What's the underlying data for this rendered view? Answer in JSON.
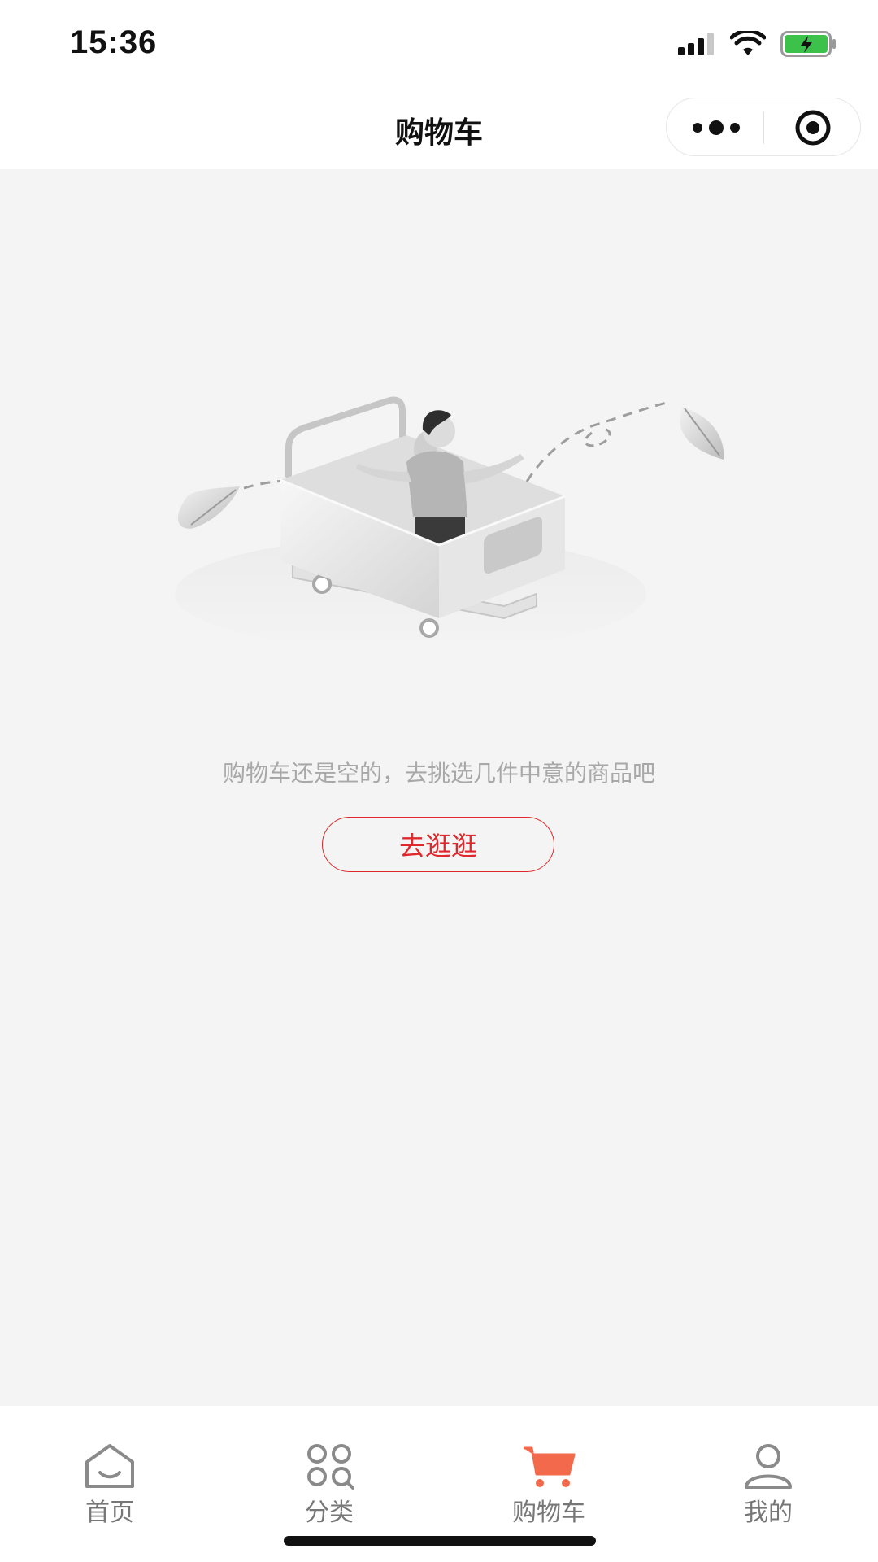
{
  "status_bar": {
    "time": "15:36",
    "signal_icon": "cellular-signal-icon",
    "wifi_icon": "wifi-icon",
    "battery_icon": "battery-charging-icon"
  },
  "nav": {
    "title": "购物车",
    "more_icon": "more-dots-icon",
    "close_icon": "target-circle-icon"
  },
  "empty_state": {
    "illustration": "empty-cart-illustration",
    "message": "购物车还是空的，去挑选几件中意的商品吧",
    "button_label": "去逛逛"
  },
  "tabs": [
    {
      "label": "首页",
      "icon": "home-icon"
    },
    {
      "label": "分类",
      "icon": "category-icon"
    },
    {
      "label": "购物车",
      "icon": "cart-icon",
      "active": true
    },
    {
      "label": "我的",
      "icon": "user-icon"
    }
  ],
  "colors": {
    "accent": "#e0282c",
    "cart_icon": "#f26a4b",
    "background": "#f4f4f4"
  }
}
